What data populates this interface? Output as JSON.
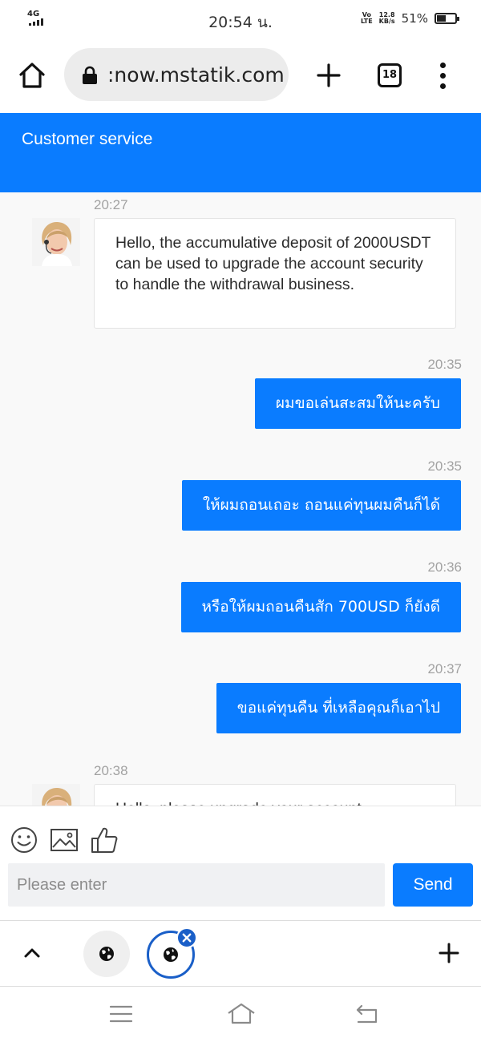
{
  "status_bar": {
    "network": "4G",
    "time": "20:54 น.",
    "volte_top": "Vo",
    "volte_bottom": "LTE",
    "speed_value": "12.8",
    "speed_unit": "KB/s",
    "battery_percent": "51%",
    "battery_level": 0.51
  },
  "browser": {
    "url": ":now.mstatik.com",
    "tab_count": "18"
  },
  "app": {
    "title": "Customer service",
    "accent_color": "#0a7cff"
  },
  "messages": [
    {
      "time": "20:27",
      "direction": "in",
      "text": "Hello, the accumulative deposit of 2000USDT can be used to upgrade the account security to handle the withdrawal business."
    },
    {
      "time": "20:35",
      "direction": "out",
      "text": "ผมขอเล่นสะสมให้นะครับ"
    },
    {
      "time": "20:35",
      "direction": "out",
      "text": "ให้ผมถอนเถอะ ถอนแค่ทุนผมคืนก็ได้"
    },
    {
      "time": "20:36",
      "direction": "out",
      "text": "หรือให้ผมถอนคืนสัก 700USD ก็ยังดี"
    },
    {
      "time": "20:37",
      "direction": "out",
      "text": "ขอแค่ทุนคืน ที่เหลือคุณก็เอาไป"
    },
    {
      "time": "20:38",
      "direction": "in",
      "text": "Hello, please upgrade your account"
    }
  ],
  "composer": {
    "placeholder": "Please enter",
    "send_label": "Send",
    "tools": [
      "emoji-icon",
      "image-icon",
      "thumbs-up-icon"
    ]
  },
  "tab_strip": {
    "icons": [
      "chevron-up-icon",
      "globe-icon",
      "globe-icon",
      "close-icon",
      "plus-icon"
    ]
  },
  "nav_bar": {
    "icons": [
      "menu-icon",
      "home-icon",
      "back-icon"
    ]
  }
}
